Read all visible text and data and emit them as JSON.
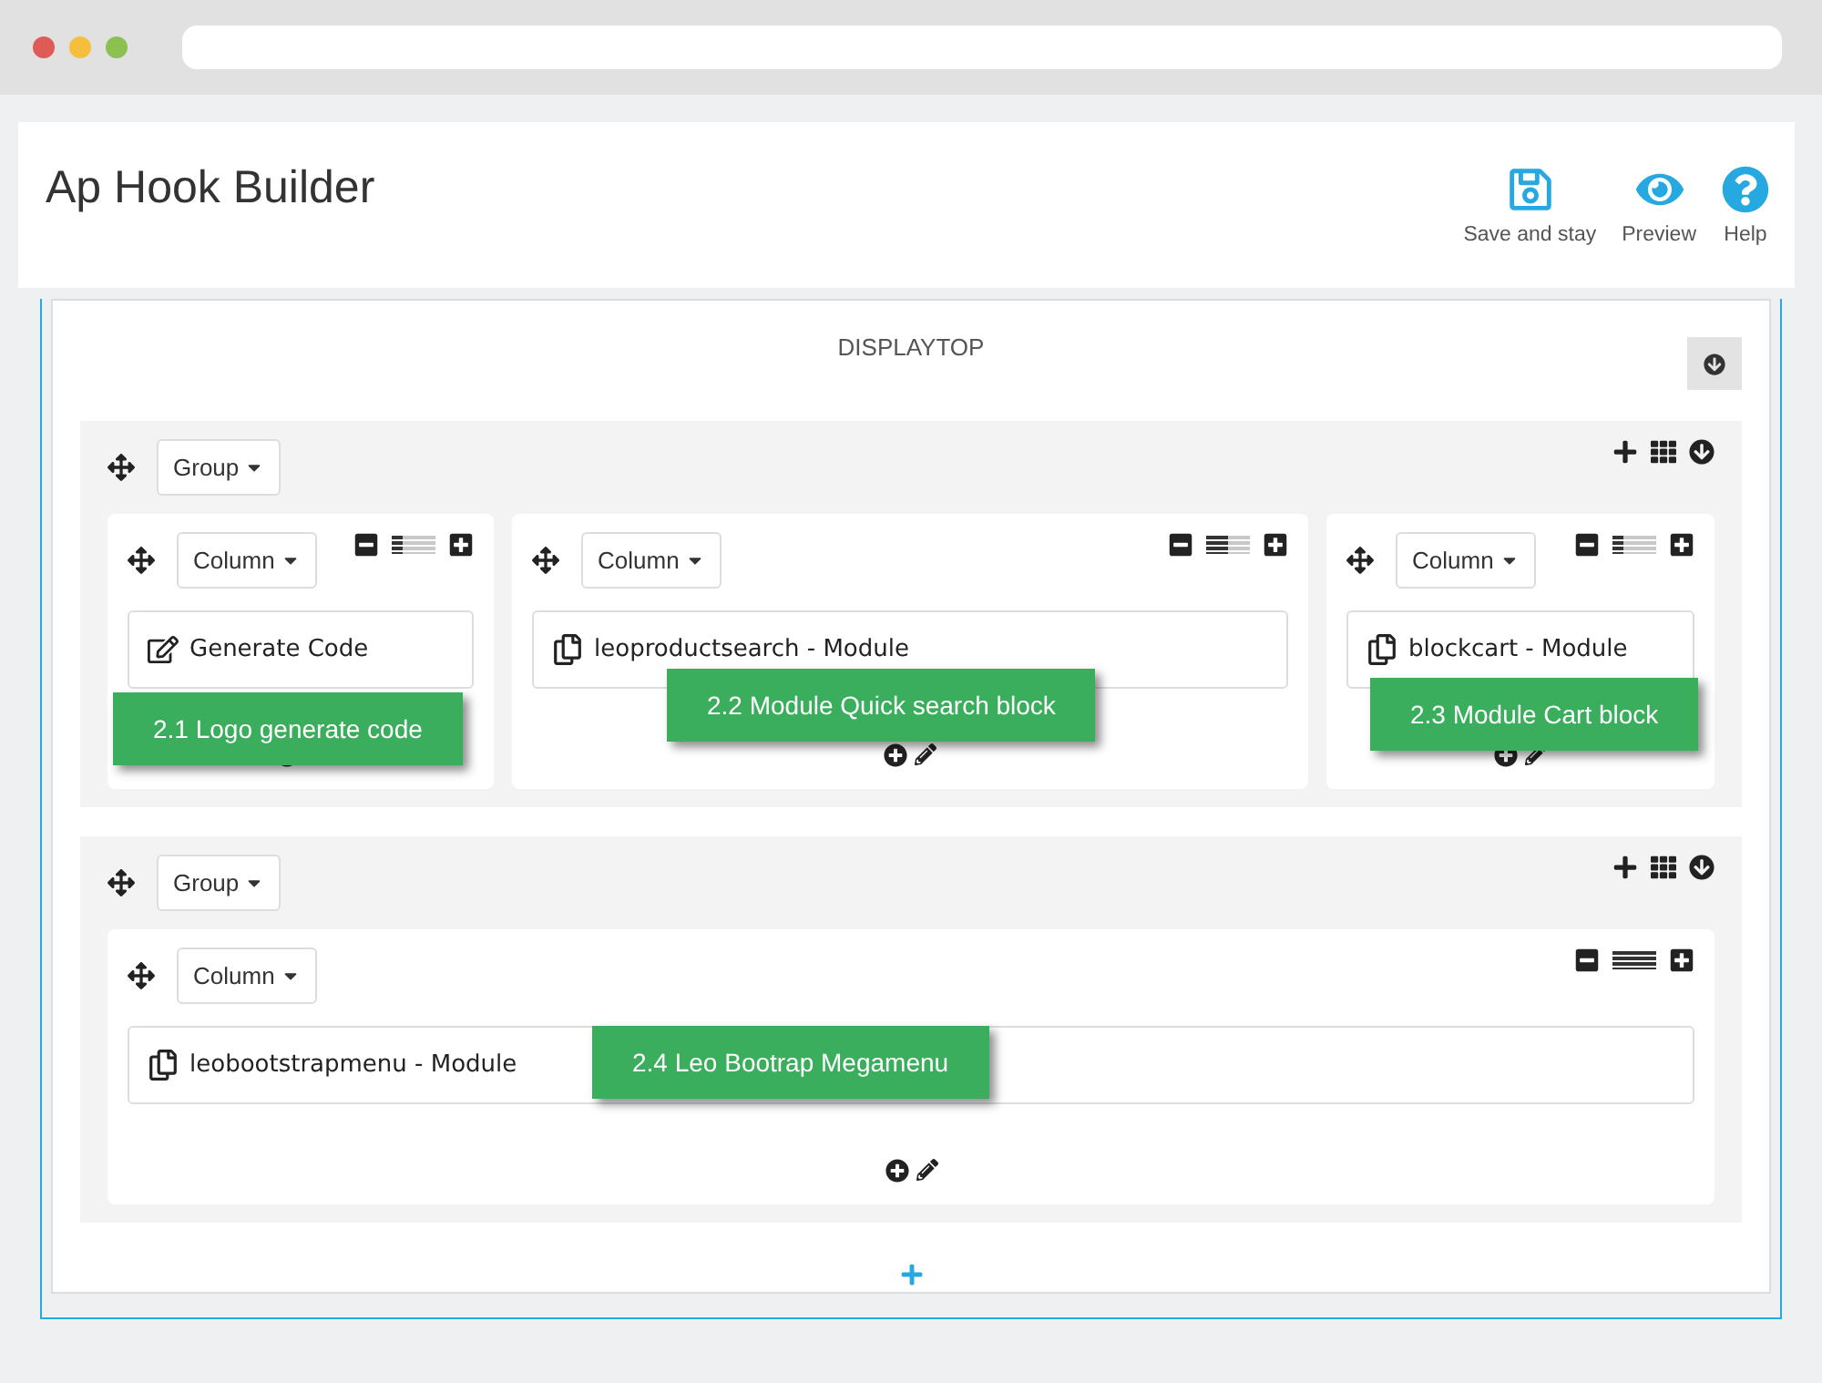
{
  "header": {
    "title": "Ap Hook Builder",
    "actions": [
      {
        "kind": "save",
        "label": "Save and stay"
      },
      {
        "kind": "preview",
        "label": "Preview"
      },
      {
        "kind": "help",
        "label": "Help"
      }
    ]
  },
  "hook": {
    "name": "DISPLAYTOP",
    "groups": [
      {
        "label": "Group",
        "columns": [
          {
            "label": "Column",
            "level": 0.25,
            "item": {
              "kind": "code",
              "text": "Generate Code"
            },
            "callout": "2.1 Logo generate code"
          },
          {
            "label": "Column",
            "level": 0.5,
            "item": {
              "kind": "module",
              "text": "leoproductsearch - Module"
            },
            "callout": "2.2 Module Quick search block"
          },
          {
            "label": "Column",
            "level": 0.25,
            "item": {
              "kind": "module",
              "text": "blockcart - Module"
            },
            "callout": "2.3 Module Cart block"
          }
        ]
      },
      {
        "label": "Group",
        "columns": [
          {
            "label": "Column",
            "level": 1,
            "item": {
              "kind": "module",
              "text": "leobootstrapmenu - Module"
            },
            "callout": "2.4 Leo Bootrap Megamenu"
          }
        ]
      }
    ]
  }
}
